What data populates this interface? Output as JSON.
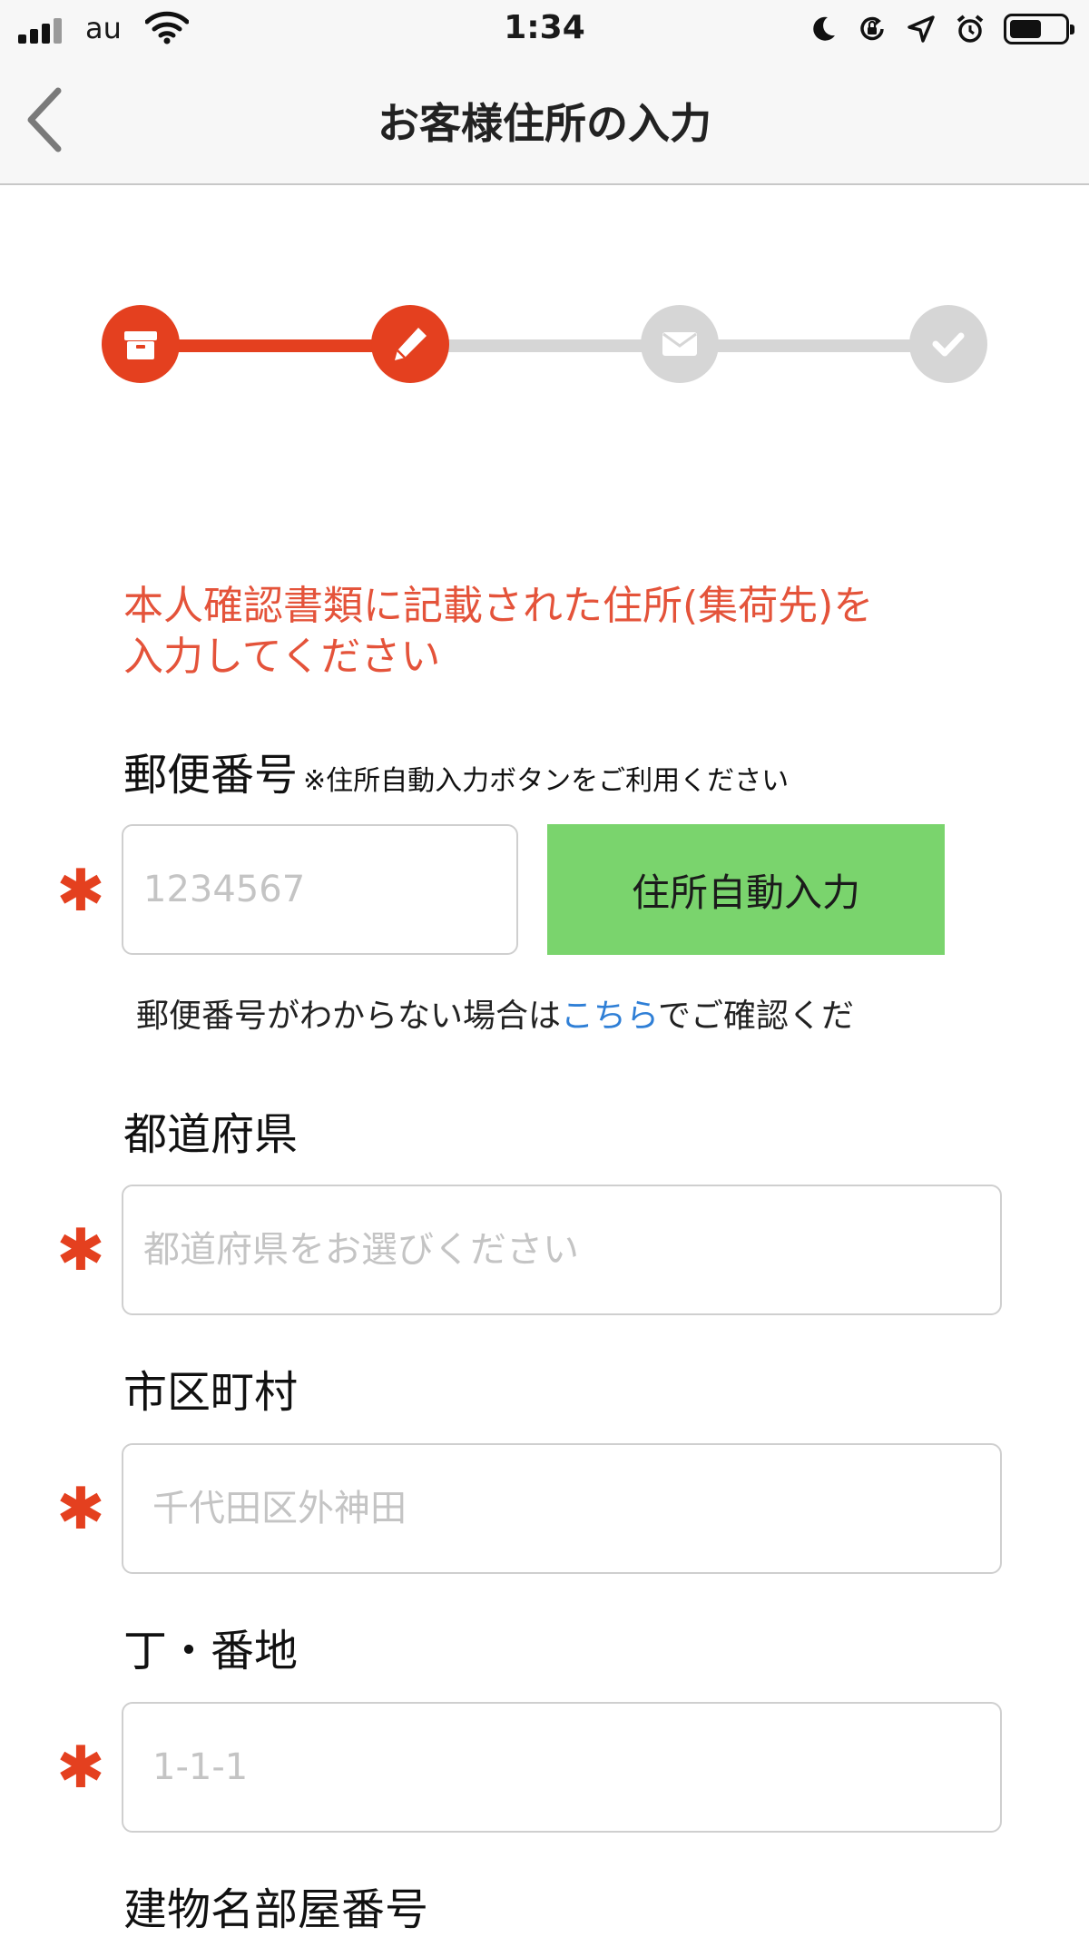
{
  "status_bar": {
    "carrier": "au",
    "time": "1:34",
    "icons": [
      "signal-icon",
      "wifi-icon",
      "moon-icon",
      "rotation-lock-icon",
      "location-icon",
      "alarm-icon",
      "battery-icon"
    ]
  },
  "nav": {
    "title": "お客様住所の入力",
    "back_icon": "chevron-left-icon"
  },
  "progress": {
    "current_step": 2,
    "total_steps": 4,
    "steps": [
      {
        "icon": "box-icon",
        "state": "done"
      },
      {
        "icon": "pencil-icon",
        "state": "active"
      },
      {
        "icon": "envelope-icon",
        "state": "pending"
      },
      {
        "icon": "check-icon",
        "state": "pending"
      }
    ],
    "colors": {
      "active": "#e4401f",
      "inactive": "#d6d6d6"
    }
  },
  "notice": {
    "line1": "本人確認書類に記載された住所(集荷先)を",
    "line2": "入力してください"
  },
  "required_mark": "✱",
  "postal": {
    "label": "郵便番号",
    "hint": "※住所自動入力ボタンをご利用ください",
    "placeholder": "1234567",
    "value": "",
    "auto_button": "住所自動入力",
    "help_before": "郵便番号がわからない場合は",
    "help_link": "こちら",
    "help_after": "でご確認くだ"
  },
  "prefecture": {
    "label": "都道府県",
    "placeholder": "都道府県をお選びください"
  },
  "city": {
    "label": "市区町村",
    "placeholder": "千代田区外神田"
  },
  "street": {
    "label": "丁・番地",
    "placeholder": "1-1-1"
  },
  "building": {
    "label": "建物名部屋番号"
  },
  "colors": {
    "accent": "#e4401f",
    "notice": "#e4533a",
    "button": "#7ad46d",
    "link": "#2f7fd6"
  }
}
